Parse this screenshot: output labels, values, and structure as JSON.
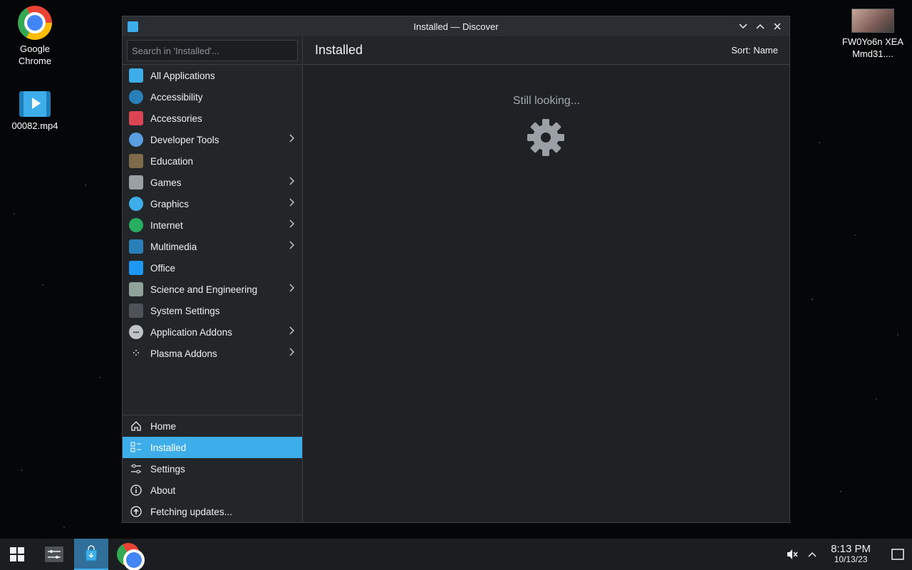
{
  "desktop": {
    "icons": [
      {
        "label": "Google Chrome",
        "icon": "chrome-icon"
      },
      {
        "label": "00082.mp4",
        "icon": "video-file-icon"
      },
      {
        "label": "FW0Yo6n XEAMmd31....",
        "icon": "image-thumbnail-icon"
      }
    ]
  },
  "window": {
    "title": "Installed — Discover",
    "controls": [
      "minimize",
      "maximize",
      "close"
    ]
  },
  "search": {
    "placeholder": "Search in 'Installed'..."
  },
  "categories": [
    {
      "label": "All Applications",
      "icon": "all-apps-icon",
      "color": "#3daee9",
      "has_submenu": false
    },
    {
      "label": "Accessibility",
      "icon": "accessibility-icon",
      "color": "#2980b9",
      "has_submenu": false
    },
    {
      "label": "Accessories",
      "icon": "accessories-icon",
      "color": "#da4453",
      "has_submenu": false
    },
    {
      "label": "Developer Tools",
      "icon": "developer-tools-icon",
      "color": "#5aa0e0",
      "has_submenu": true
    },
    {
      "label": "Education",
      "icon": "education-icon",
      "color": "#7f6a4a",
      "has_submenu": false
    },
    {
      "label": "Games",
      "icon": "games-icon",
      "color": "#9aa0a6",
      "has_submenu": true
    },
    {
      "label": "Graphics",
      "icon": "graphics-icon",
      "color": "#3daee9",
      "has_submenu": true
    },
    {
      "label": "Internet",
      "icon": "internet-icon",
      "color": "#27ae60",
      "has_submenu": true
    },
    {
      "label": "Multimedia",
      "icon": "multimedia-icon",
      "color": "#2980b9",
      "has_submenu": true
    },
    {
      "label": "Office",
      "icon": "office-icon",
      "color": "#1d99f3",
      "has_submenu": false
    },
    {
      "label": "Science and Engineering",
      "icon": "science-icon",
      "color": "#8fa39a",
      "has_submenu": true
    },
    {
      "label": "System Settings",
      "icon": "system-settings-icon",
      "color": "#4d5359",
      "has_submenu": false
    },
    {
      "label": "Application Addons",
      "icon": "application-addons-icon",
      "color": "#bdc3c7",
      "has_submenu": true
    },
    {
      "label": "Plasma Addons",
      "icon": "plasma-addons-icon",
      "color": "#eff0f1",
      "has_submenu": true
    }
  ],
  "bottom_nav": [
    {
      "label": "Home",
      "icon": "home-icon",
      "selected": false
    },
    {
      "label": "Installed",
      "icon": "installed-icon",
      "selected": true
    },
    {
      "label": "Settings",
      "icon": "settings-icon",
      "selected": false
    },
    {
      "label": "About",
      "icon": "about-icon",
      "selected": false
    },
    {
      "label": "Fetching updates...",
      "icon": "update-icon",
      "selected": false
    }
  ],
  "main": {
    "title": "Installed",
    "sort_label": "Sort: Name",
    "status_text": "Still looking...",
    "status_icon": "gear-icon"
  },
  "taskbar": {
    "items": [
      "start-menu-icon",
      "system-settings-icon",
      "discover-icon",
      "chrome-icon"
    ],
    "active": "discover-icon",
    "tray": [
      "volume-muted-icon",
      "tray-expand-icon",
      "show-desktop-icon"
    ],
    "time": "8:13 PM",
    "date": "10/13/23"
  },
  "colors": {
    "accent": "#3daee9",
    "window_bg": "#232629",
    "content_bg": "#1f2225"
  }
}
